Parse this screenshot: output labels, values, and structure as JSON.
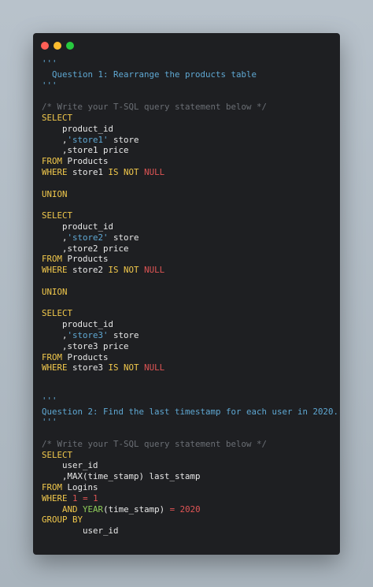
{
  "window": {
    "traffic_lights": [
      {
        "name": "close-button",
        "color": "#ff5f56"
      },
      {
        "name": "minimize-button",
        "color": "#ffbd2e"
      },
      {
        "name": "zoom-button",
        "color": "#27c93f"
      }
    ]
  },
  "colors": {
    "default": "#e8e8e8",
    "doc": "#5fa8d3",
    "comment": "#6b6f75",
    "keyword": "#f2c94c",
    "string": "#5fa8d3",
    "null": "#e05555",
    "number": "#e05555",
    "function": "#8fce5a"
  },
  "code_lines": [
    [
      {
        "t": "'''",
        "c": "doc"
      }
    ],
    [
      {
        "t": "  Question 1: Rearrange the products table",
        "c": "doc"
      }
    ],
    [
      {
        "t": "'''",
        "c": "doc"
      }
    ],
    [],
    [
      {
        "t": "/* Write your T-SQL query statement below */",
        "c": "comment"
      }
    ],
    [
      {
        "t": "SELECT",
        "c": "keyword"
      }
    ],
    [
      {
        "t": "    product_id",
        "c": "default"
      }
    ],
    [
      {
        "t": "    ,",
        "c": "default"
      },
      {
        "t": "'store1'",
        "c": "string"
      },
      {
        "t": " store",
        "c": "default"
      }
    ],
    [
      {
        "t": "    ,store1 price",
        "c": "default"
      }
    ],
    [
      {
        "t": "FROM",
        "c": "keyword"
      },
      {
        "t": " Products",
        "c": "default"
      }
    ],
    [
      {
        "t": "WHERE",
        "c": "keyword"
      },
      {
        "t": " store1 ",
        "c": "default"
      },
      {
        "t": "IS NOT",
        "c": "keyword"
      },
      {
        "t": " ",
        "c": "default"
      },
      {
        "t": "NULL",
        "c": "null"
      }
    ],
    [],
    [
      {
        "t": "UNION",
        "c": "keyword"
      }
    ],
    [],
    [
      {
        "t": "SELECT",
        "c": "keyword"
      }
    ],
    [
      {
        "t": "    product_id",
        "c": "default"
      }
    ],
    [
      {
        "t": "    ,",
        "c": "default"
      },
      {
        "t": "'store2'",
        "c": "string"
      },
      {
        "t": " store",
        "c": "default"
      }
    ],
    [
      {
        "t": "    ,store2 price",
        "c": "default"
      }
    ],
    [
      {
        "t": "FROM",
        "c": "keyword"
      },
      {
        "t": " Products",
        "c": "default"
      }
    ],
    [
      {
        "t": "WHERE",
        "c": "keyword"
      },
      {
        "t": " store2 ",
        "c": "default"
      },
      {
        "t": "IS NOT",
        "c": "keyword"
      },
      {
        "t": " ",
        "c": "default"
      },
      {
        "t": "NULL",
        "c": "null"
      }
    ],
    [],
    [
      {
        "t": "UNION",
        "c": "keyword"
      }
    ],
    [],
    [
      {
        "t": "SELECT",
        "c": "keyword"
      }
    ],
    [
      {
        "t": "    product_id",
        "c": "default"
      }
    ],
    [
      {
        "t": "    ,",
        "c": "default"
      },
      {
        "t": "'store3'",
        "c": "string"
      },
      {
        "t": " store",
        "c": "default"
      }
    ],
    [
      {
        "t": "    ,store3 price",
        "c": "default"
      }
    ],
    [
      {
        "t": "FROM",
        "c": "keyword"
      },
      {
        "t": " Products",
        "c": "default"
      }
    ],
    [
      {
        "t": "WHERE",
        "c": "keyword"
      },
      {
        "t": " store3 ",
        "c": "default"
      },
      {
        "t": "IS NOT",
        "c": "keyword"
      },
      {
        "t": " ",
        "c": "default"
      },
      {
        "t": "NULL",
        "c": "null"
      }
    ],
    [],
    [],
    [
      {
        "t": "'''",
        "c": "doc"
      }
    ],
    [
      {
        "t": "Question 2: Find the last timestamp for each user in 2020.",
        "c": "doc"
      }
    ],
    [
      {
        "t": "'''",
        "c": "doc"
      }
    ],
    [],
    [
      {
        "t": "/* Write your T-SQL query statement below */",
        "c": "comment"
      }
    ],
    [
      {
        "t": "SELECT",
        "c": "keyword"
      }
    ],
    [
      {
        "t": "    user_id",
        "c": "default"
      }
    ],
    [
      {
        "t": "    ,MAX(time_stamp) last_stamp",
        "c": "default"
      }
    ],
    [
      {
        "t": "FROM",
        "c": "keyword"
      },
      {
        "t": " Logins",
        "c": "default"
      }
    ],
    [
      {
        "t": "WHERE",
        "c": "keyword"
      },
      {
        "t": " ",
        "c": "default"
      },
      {
        "t": "1",
        "c": "number"
      },
      {
        "t": " ",
        "c": "default"
      },
      {
        "t": "=",
        "c": "number"
      },
      {
        "t": " ",
        "c": "default"
      },
      {
        "t": "1",
        "c": "number"
      }
    ],
    [
      {
        "t": "    ",
        "c": "default"
      },
      {
        "t": "AND",
        "c": "keyword"
      },
      {
        "t": " ",
        "c": "default"
      },
      {
        "t": "YEAR",
        "c": "function"
      },
      {
        "t": "(time_stamp) ",
        "c": "default"
      },
      {
        "t": "=",
        "c": "number"
      },
      {
        "t": " ",
        "c": "default"
      },
      {
        "t": "2020",
        "c": "number"
      }
    ],
    [
      {
        "t": "GROUP BY",
        "c": "keyword"
      }
    ],
    [
      {
        "t": "        user_id",
        "c": "default"
      }
    ]
  ]
}
